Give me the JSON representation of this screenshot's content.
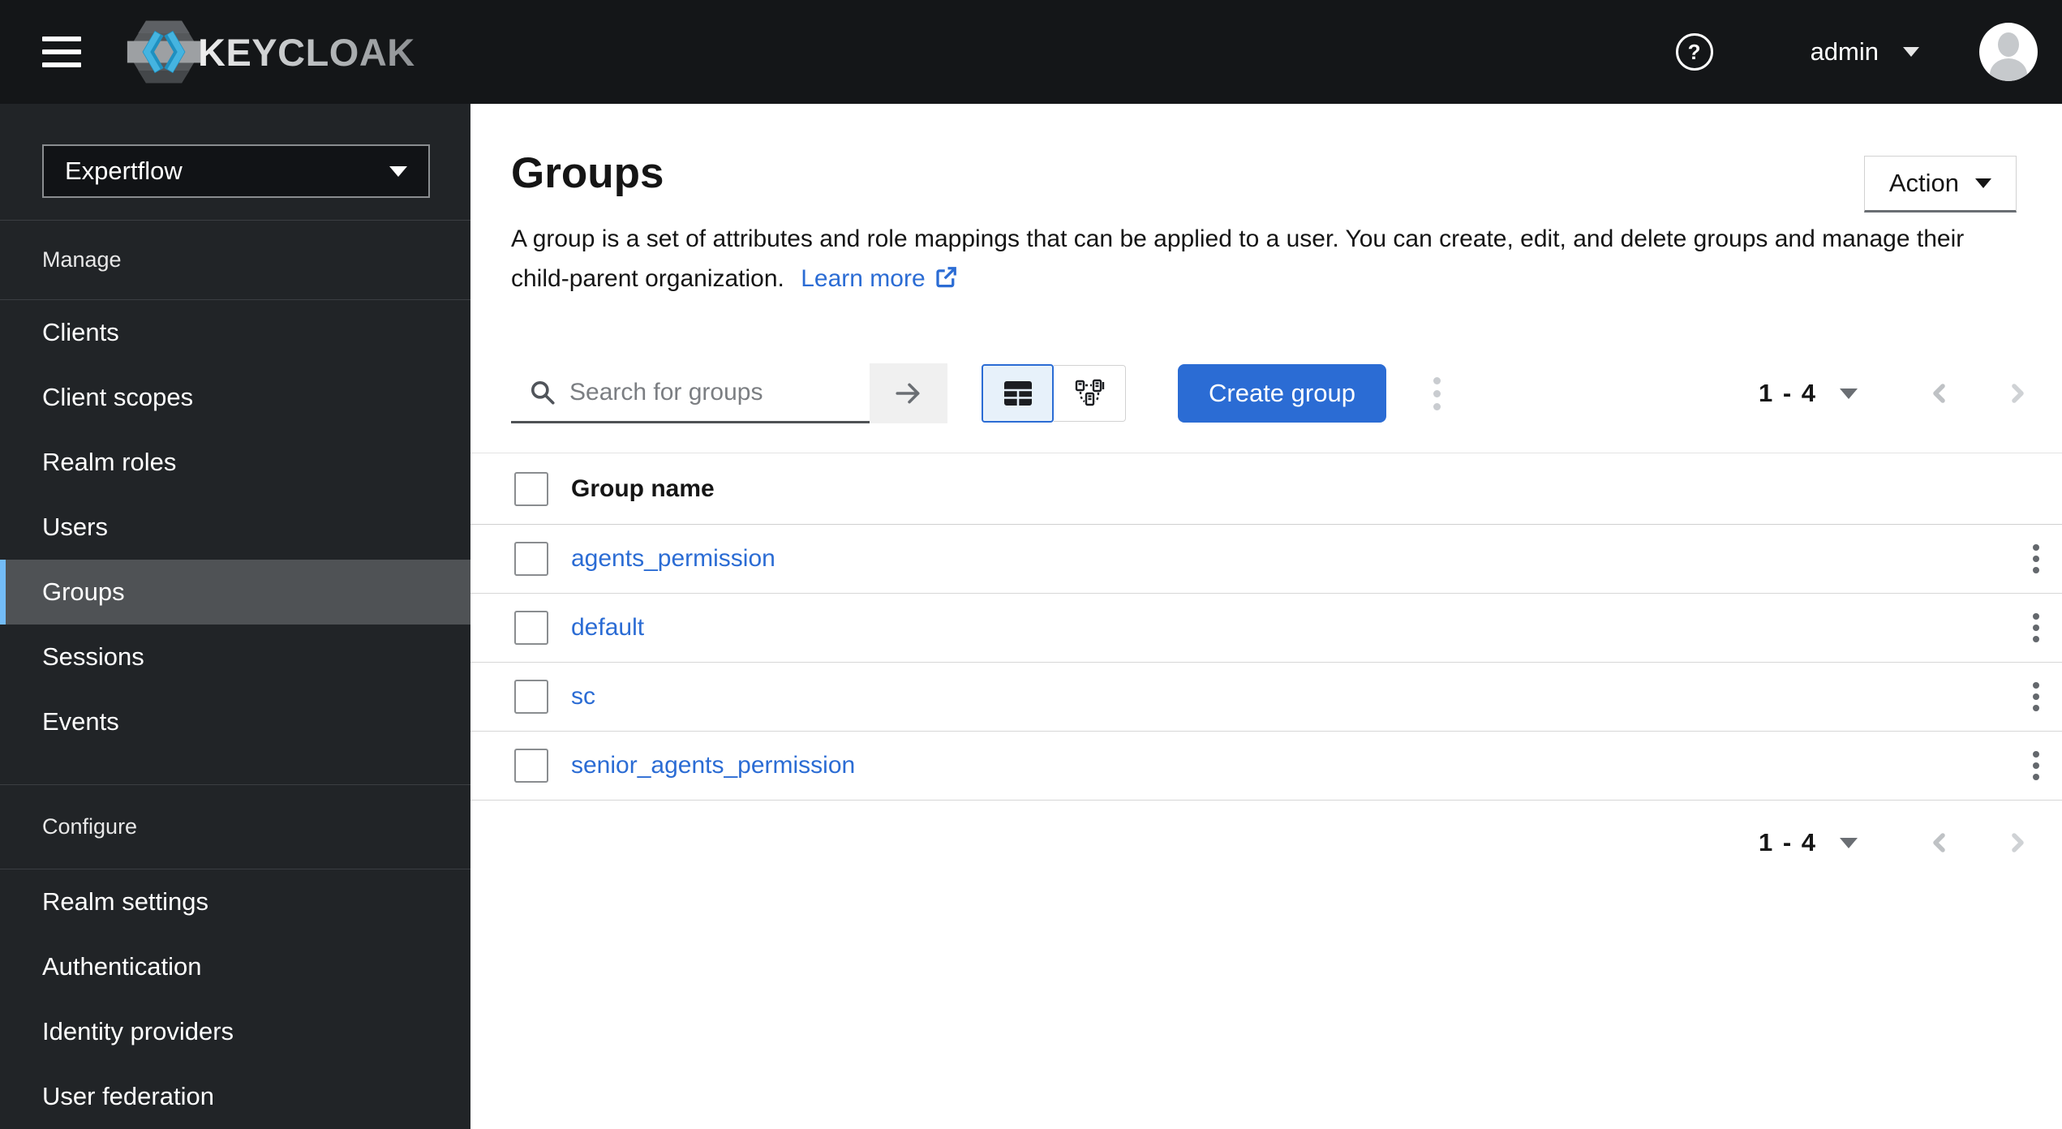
{
  "colors": {
    "masthead_bg": "#141618",
    "sidebar_bg": "#212427",
    "nav_selected_bg": "#4f5255",
    "nav_selected_accent": "#73bcf7",
    "accent_blue": "#2b6cd4",
    "link_blue": "#2b6cd4",
    "toggle_selected_bg": "#e7f1fa",
    "text_dark": "#151515",
    "muted_gray": "#6a6e73",
    "border_light": "#d2d2d2"
  },
  "masthead": {
    "brand": "KEYCLOAK",
    "help_glyph": "?",
    "username": "admin"
  },
  "sidebar": {
    "realm_switcher": "Expertflow",
    "selected_item": "Groups",
    "sections": [
      {
        "title": "Manage",
        "items": [
          "Clients",
          "Client scopes",
          "Realm roles",
          "Users",
          "Groups",
          "Sessions",
          "Events"
        ]
      },
      {
        "title": "Configure",
        "items": [
          "Realm settings",
          "Authentication",
          "Identity providers",
          "User federation"
        ]
      }
    ]
  },
  "page": {
    "title": "Groups",
    "description": "A group is a set of attributes and role mappings that can be applied to a user. You can create, edit, and delete groups and manage their child-parent organization.",
    "learn_more": "Learn more",
    "action_button": "Action"
  },
  "toolbar": {
    "search_placeholder": "Search for groups",
    "create_button": "Create group",
    "pagination": {
      "range": "1 - 4"
    }
  },
  "table": {
    "column": "Group name",
    "rows": [
      "agents_permission",
      "default",
      "sc",
      "senior_agents_permission"
    ]
  }
}
